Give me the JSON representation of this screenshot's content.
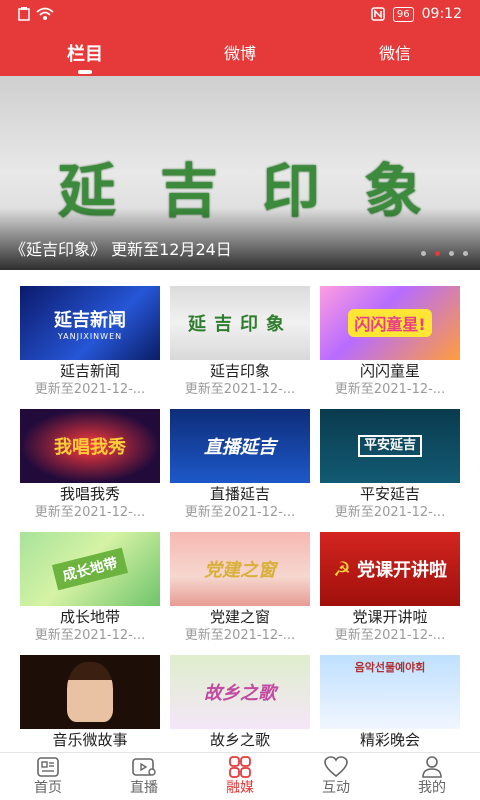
{
  "status": {
    "battery": "96",
    "time": "09:12"
  },
  "top_tabs": [
    "栏目",
    "微博",
    "微信"
  ],
  "banner": {
    "logo": "延吉印象",
    "caption": "《延吉印象》 更新至12月24日"
  },
  "cards": [
    {
      "title": "延吉新闻",
      "sub": "更新至2021-12-...",
      "thumb": "延吉新闻",
      "thumb2": "YANJIXINWEN"
    },
    {
      "title": "延吉印象",
      "sub": "更新至2021-12-...",
      "thumb": "延吉印象"
    },
    {
      "title": "闪闪童星",
      "sub": "更新至2021-12-...",
      "thumb": "闪闪童星!"
    },
    {
      "title": "我唱我秀",
      "sub": "更新至2021-12-...",
      "thumb": "我唱我秀"
    },
    {
      "title": "直播延吉",
      "sub": "更新至2021-12-...",
      "thumb": "直播延吉"
    },
    {
      "title": "平安延吉",
      "sub": "更新至2021-12-...",
      "thumb": "平安延吉"
    },
    {
      "title": "成长地带",
      "sub": "更新至2021-12-...",
      "thumb": "成长地带"
    },
    {
      "title": "党建之窗",
      "sub": "更新至2021-12-...",
      "thumb": "党建之窗"
    },
    {
      "title": "党课开讲啦",
      "sub": "更新至2021-12-...",
      "thumb": "党课开讲啦"
    },
    {
      "title": "音乐微故事",
      "sub": "",
      "thumb": ""
    },
    {
      "title": "故乡之歌",
      "sub": "",
      "thumb": "故乡之歌"
    },
    {
      "title": "精彩晚会",
      "sub": "",
      "thumb": "음악선물예야회"
    }
  ],
  "bottom_nav": [
    {
      "label": "首页",
      "icon": "news-icon"
    },
    {
      "label": "直播",
      "icon": "live-tv-icon"
    },
    {
      "label": "融媒",
      "icon": "grid-icon"
    },
    {
      "label": "互动",
      "icon": "heart-icon"
    },
    {
      "label": "我的",
      "icon": "person-icon"
    }
  ],
  "colors": {
    "brand": "#e63a3a",
    "inactive": "#666666"
  }
}
